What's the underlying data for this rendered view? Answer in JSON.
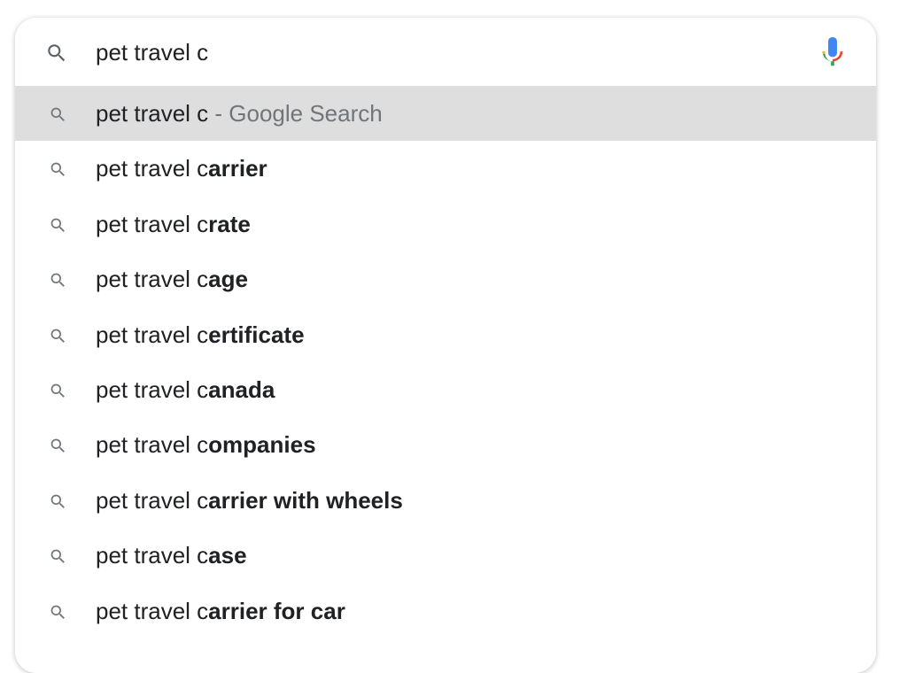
{
  "search": {
    "query": "pet travel c",
    "search_icon": "search-icon",
    "mic_icon": "microphone-icon",
    "mic_colors": [
      "#4285f4",
      "#ea4335",
      "#fbbc05",
      "#34a853"
    ]
  },
  "suggestions": [
    {
      "typed": "pet travel c",
      "completion": "",
      "suffix": " - Google Search",
      "highlighted": true
    },
    {
      "typed": "pet travel c",
      "completion": "arrier",
      "suffix": "",
      "highlighted": false
    },
    {
      "typed": "pet travel c",
      "completion": "rate",
      "suffix": "",
      "highlighted": false
    },
    {
      "typed": "pet travel c",
      "completion": "age",
      "suffix": "",
      "highlighted": false
    },
    {
      "typed": "pet travel c",
      "completion": "ertificate",
      "suffix": "",
      "highlighted": false
    },
    {
      "typed": "pet travel c",
      "completion": "anada",
      "suffix": "",
      "highlighted": false
    },
    {
      "typed": "pet travel c",
      "completion": "ompanies",
      "suffix": "",
      "highlighted": false
    },
    {
      "typed": "pet travel c",
      "completion": "arrier with wheels",
      "suffix": "",
      "highlighted": false
    },
    {
      "typed": "pet travel c",
      "completion": "ase",
      "suffix": "",
      "highlighted": false
    },
    {
      "typed": "pet travel c",
      "completion": "arrier for car",
      "suffix": "",
      "highlighted": false
    }
  ],
  "colors": {
    "highlight_row": "#dedede",
    "text": "#202124",
    "suffix_text": "#70757a",
    "icon": "#5f6368"
  }
}
